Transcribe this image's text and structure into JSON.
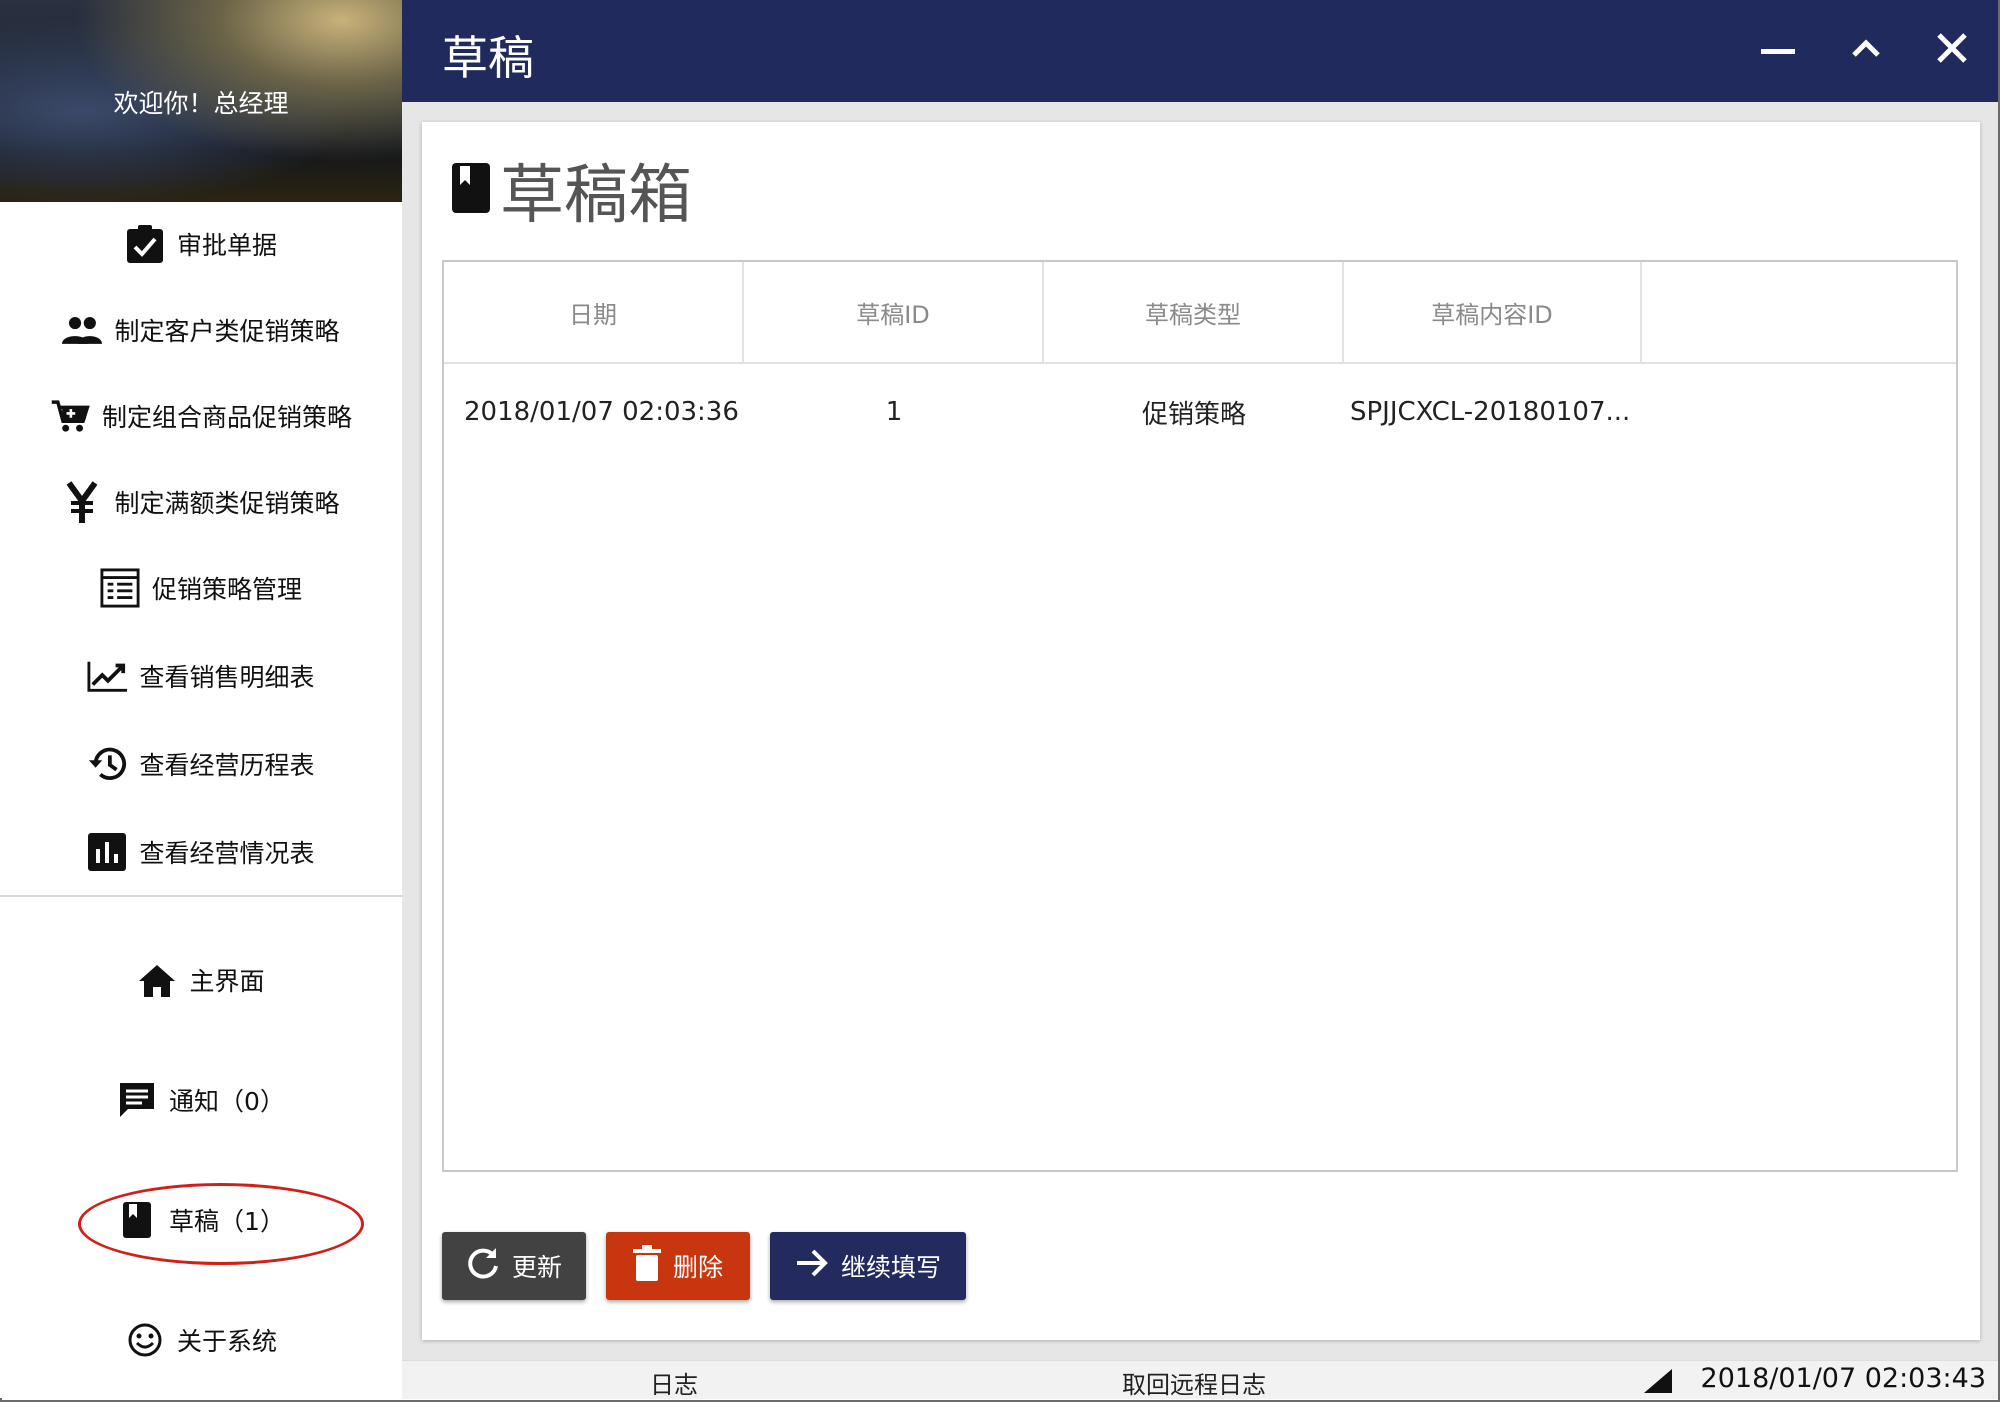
{
  "sidebar": {
    "welcome": "欢迎你！总经理",
    "items": [
      {
        "label": "审批单据",
        "icon": "clipboard-check-icon"
      },
      {
        "label": "制定客户类促销策略",
        "icon": "people-icon"
      },
      {
        "label": "制定组合商品促销策略",
        "icon": "cart-add-icon"
      },
      {
        "label": "制定满额类促销策略",
        "icon": "yen-icon"
      },
      {
        "label": "促销策略管理",
        "icon": "list-box-icon"
      },
      {
        "label": "查看销售明细表",
        "icon": "trending-up-icon"
      },
      {
        "label": "查看经营历程表",
        "icon": "history-icon"
      },
      {
        "label": "查看经营情况表",
        "icon": "bar-chart-icon"
      }
    ],
    "bottom": [
      {
        "label": "主界面",
        "icon": "home-icon"
      },
      {
        "label": "通知（0）",
        "icon": "message-icon"
      },
      {
        "label": "草稿（1）",
        "icon": "bookmark-icon"
      },
      {
        "label": "关于系统",
        "icon": "smiley-icon"
      }
    ]
  },
  "window": {
    "title": "草稿",
    "controls": {
      "minimize": "minimize-icon",
      "maximize": "chevron-up-icon",
      "close": "close-icon"
    }
  },
  "main": {
    "heading": "草稿箱",
    "heading_icon": "bookmark-icon",
    "table": {
      "columns": [
        "日期",
        "草稿ID",
        "草稿类型",
        "草稿内容ID",
        ""
      ],
      "rows": [
        [
          "2018/01/07 02:03:36",
          "1",
          "促销策略",
          "SPJJCXCL-20180107..."
        ]
      ]
    },
    "buttons": {
      "refresh": "更新",
      "delete": "删除",
      "continue": "继续填写"
    }
  },
  "statusbar": {
    "log": "日志",
    "remote_log": "取回远程日志",
    "time": "2018/01/07 02:03:43"
  },
  "colors": {
    "titlebar": "#212a5c",
    "delete": "#c8360f",
    "refresh": "#424242",
    "continue": "#232b5e",
    "highlight": "#d0201a"
  }
}
